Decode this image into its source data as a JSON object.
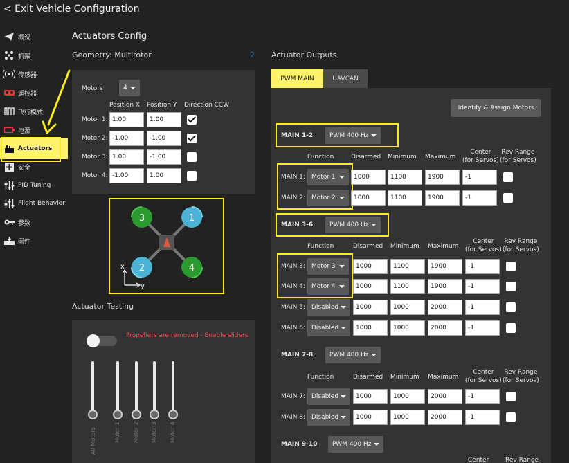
{
  "header": {
    "exit": "< Exit Vehicle Configuration"
  },
  "sidebar": {
    "items": [
      {
        "label": "概況",
        "icon": "paper-plane-icon"
      },
      {
        "label": "机架",
        "icon": "frame-icon"
      },
      {
        "label": "传感器",
        "icon": "sensor-icon"
      },
      {
        "label": "遥控器",
        "icon": "radio-icon"
      },
      {
        "label": "飞行模式",
        "icon": "flight-modes-icon"
      },
      {
        "label": "电源",
        "icon": "battery-icon"
      },
      {
        "label": "Actuators",
        "icon": "actuators-icon"
      },
      {
        "label": "安全",
        "icon": "safety-icon"
      },
      {
        "label": "PID Tuning",
        "icon": "pid-tuning-icon"
      },
      {
        "label": "Flight Behavior",
        "icon": "flight-behavior-icon"
      },
      {
        "label": "参数",
        "icon": "parameters-icon"
      },
      {
        "label": "固件",
        "icon": "firmware-icon"
      }
    ]
  },
  "config": {
    "title": "Actuators Config",
    "geometry": "Geometry: Multirotor",
    "collapse_marker": "2",
    "motors_label": "Motors",
    "motors_count": "4",
    "col_pos_x": "Position X",
    "col_pos_y": "Position Y",
    "col_dir": "Direction CCW",
    "motors": [
      {
        "label": "Motor 1:",
        "x": "1.00",
        "y": "1.00",
        "ccw": true
      },
      {
        "label": "Motor 2:",
        "x": "-1.00",
        "y": "-1.00",
        "ccw": true
      },
      {
        "label": "Motor 3:",
        "x": "1.00",
        "y": "-1.00",
        "ccw": false
      },
      {
        "label": "Motor 4:",
        "x": "-1.00",
        "y": "1.00",
        "ccw": false
      }
    ],
    "diagram": {
      "m1": "1",
      "m2": "2",
      "m3": "3",
      "m4": "4",
      "x": "x",
      "y": "y"
    }
  },
  "testing": {
    "title": "Actuator Testing",
    "warning": "Propellers are removed - Enable sliders",
    "sliders": [
      "All Motors",
      "Motor 1",
      "Motor 2",
      "Motor 3",
      "Motor 4"
    ]
  },
  "outputs": {
    "title": "Actuator Outputs",
    "tabs": [
      "PWM MAIN",
      "UAVCAN"
    ],
    "identify_button": "Identify & Assign Motors",
    "col_function": "Function",
    "col_disarmed": "Disarmed",
    "col_min": "Minimum",
    "col_max": "Maximum",
    "col_center_1": "Center",
    "col_center_2": "(for Servos)",
    "col_rev_1": "Rev Range",
    "col_rev_2": "(for Servos)",
    "groups": [
      {
        "label": "MAIN 1-2",
        "rate": "PWM 400 Hz"
      },
      {
        "label": "MAIN 3-6",
        "rate": "PWM 400 Hz"
      },
      {
        "label": "MAIN 7-8",
        "rate": "PWM 400 Hz"
      },
      {
        "label": "MAIN 9-10",
        "rate": "PWM 400 Hz"
      }
    ],
    "rows": [
      {
        "label": "MAIN 1:",
        "function": "Motor 1",
        "disarmed": "1000",
        "min": "1100",
        "max": "1900",
        "center": "-1"
      },
      {
        "label": "MAIN 2:",
        "function": "Motor 2",
        "disarmed": "1000",
        "min": "1100",
        "max": "1900",
        "center": "-1"
      },
      {
        "label": "MAIN 3:",
        "function": "Motor 3",
        "disarmed": "1000",
        "min": "1100",
        "max": "1900",
        "center": "-1"
      },
      {
        "label": "MAIN 4:",
        "function": "Motor 4",
        "disarmed": "1000",
        "min": "1100",
        "max": "1900",
        "center": "-1"
      },
      {
        "label": "MAIN 5:",
        "function": "Disabled",
        "disarmed": "1000",
        "min": "1000",
        "max": "2000",
        "center": "-1"
      },
      {
        "label": "MAIN 6:",
        "function": "Disabled",
        "disarmed": "1000",
        "min": "1000",
        "max": "2000",
        "center": "-1"
      },
      {
        "label": "MAIN 7:",
        "function": "Disabled",
        "disarmed": "1000",
        "min": "1000",
        "max": "2000",
        "center": "-1"
      },
      {
        "label": "MAIN 8:",
        "function": "Disabled",
        "disarmed": "1000",
        "min": "1000",
        "max": "2000",
        "center": "-1"
      }
    ]
  },
  "colors": {
    "highlight": "#ffeb1a",
    "active_tab": "#fff36b",
    "motor_cw": "#2a9a2e",
    "motor_ccw": "#4bb3d6",
    "warning": "#e05656"
  }
}
